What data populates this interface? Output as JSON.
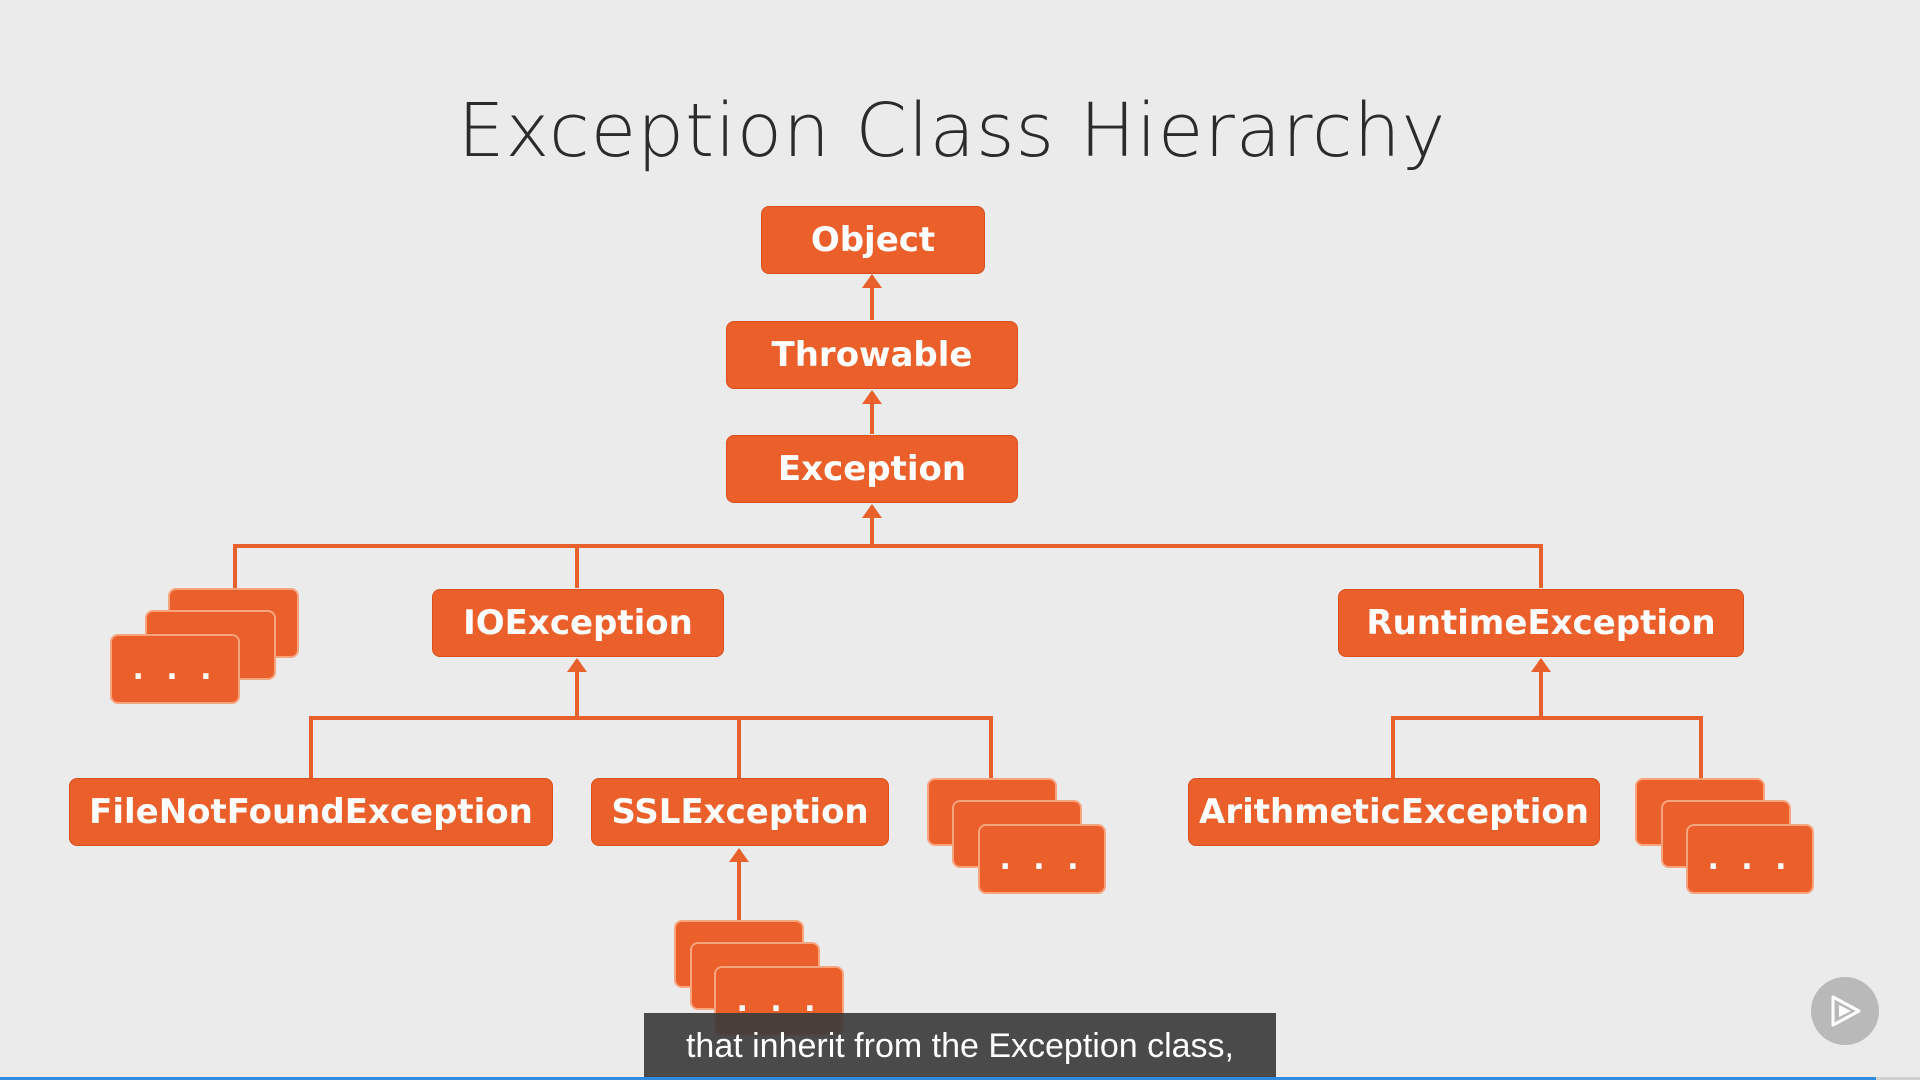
{
  "slide": {
    "title": "Exception Class Hierarchy"
  },
  "nodes": {
    "object": "Object",
    "throwable": "Throwable",
    "exception": "Exception",
    "ioexception": "IOException",
    "runtimeexception": "RuntimeException",
    "filenotfound": "FileNotFoundException",
    "sslexception": "SSLException",
    "arithmetic": "ArithmeticException"
  },
  "more_label": ". . .",
  "caption": {
    "text": "that inherit from the Exception class,"
  },
  "player": {
    "progress": 0.977,
    "play_icon": "play-logo-icon"
  },
  "colors": {
    "node": "#eb5f2a",
    "connector": "#e8612c",
    "background": "#ebebeb",
    "progress": "#2f8be0"
  }
}
